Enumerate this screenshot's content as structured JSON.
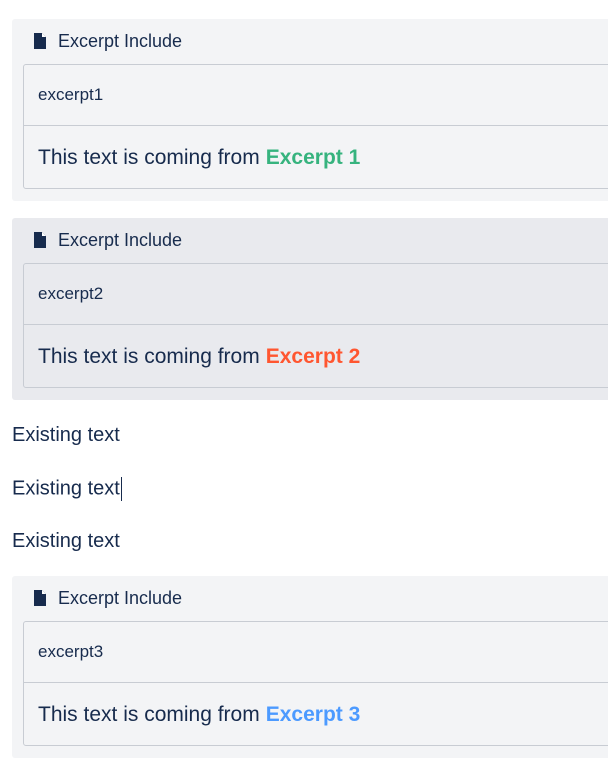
{
  "macro_title": "Excerpt Include",
  "excerpts": [
    {
      "name": "excerpt1",
      "text": "This text is coming from",
      "highlight": "Excerpt 1",
      "highlight_color": "#36b37e"
    },
    {
      "name": "excerpt2",
      "text": "This text is coming from",
      "highlight": "Excerpt 2",
      "highlight_color": "#ff5630"
    },
    {
      "name": "excerpt3",
      "text": "This text is coming from",
      "highlight": "Excerpt 3",
      "highlight_color": "#4c9aff"
    }
  ],
  "existing_lines": [
    "Existing text",
    "Existing text",
    "Existing text"
  ],
  "icons": {
    "macro_icon": "document-icon"
  }
}
